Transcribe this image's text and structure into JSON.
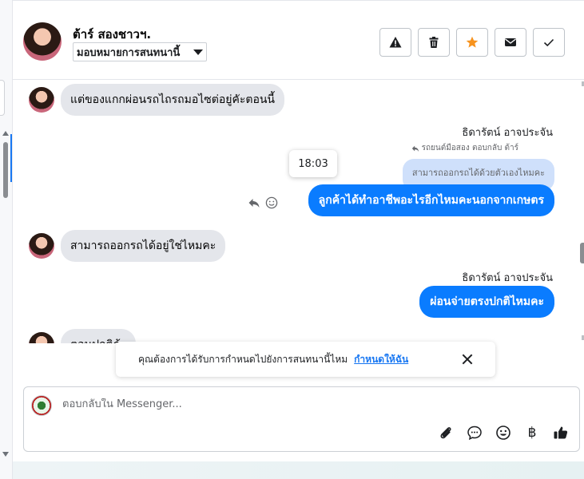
{
  "contact": {
    "name": "ต้าร์ สองชาวฯ.",
    "assign_label": "มอบหมายการสนทนานี้"
  },
  "header_actions": [
    {
      "name": "warning",
      "icon": "warning-icon"
    },
    {
      "name": "delete",
      "icon": "trash-icon"
    },
    {
      "name": "star",
      "icon": "star-icon",
      "color": "#f7931e"
    },
    {
      "name": "unread",
      "icon": "envelope-icon"
    },
    {
      "name": "done",
      "icon": "check-icon"
    }
  ],
  "messages": {
    "m1": "แต่ของแกกผ่อนรถไถรถมอไซต่อยู่คัะตอนนี้",
    "m2_sender": "ธิดารัตน์ อาจประจัน",
    "m2_reply_meta": "รถยนต์มือสอง ตอบกลับ ต้าร์",
    "m2_quoted": "สามารถออกรถได้ด้วยตัวเองไหมคะ",
    "m2_time": "18:03",
    "m2": "ลูกค้าได้ทำอาชีพอะไรอีกไหมคะนอกจากเกษตร",
    "m3": "สามารถออกรถได้อยู่ใช่ไหมคะ",
    "m4_sender": "ธิดารัตน์ อาจประจัน",
    "m4": "ผ่อนจ่ายตรงปกติไหมคะ",
    "m5_partial": "ตอนปกติค้ะ"
  },
  "follow_up": {
    "text": "คุณต้องการได้รับการกำหนดไปยังการสนทนานี้ไหม",
    "link": "กำหนดให้ฉัน"
  },
  "composer": {
    "placeholder": "ตอบกลับใน Messenger..."
  },
  "composer_tools": [
    "paperclip-icon",
    "speech-bubble-icon",
    "emoji-icon",
    "baht-icon",
    "thumbs-up-icon"
  ],
  "baht_symbol": "฿",
  "colors": {
    "outgoing_bubble": "#0a7cff",
    "incoming_bubble": "#e4e6eb",
    "quoted_bubble": "#cfe0fb",
    "link": "#1877f2"
  }
}
